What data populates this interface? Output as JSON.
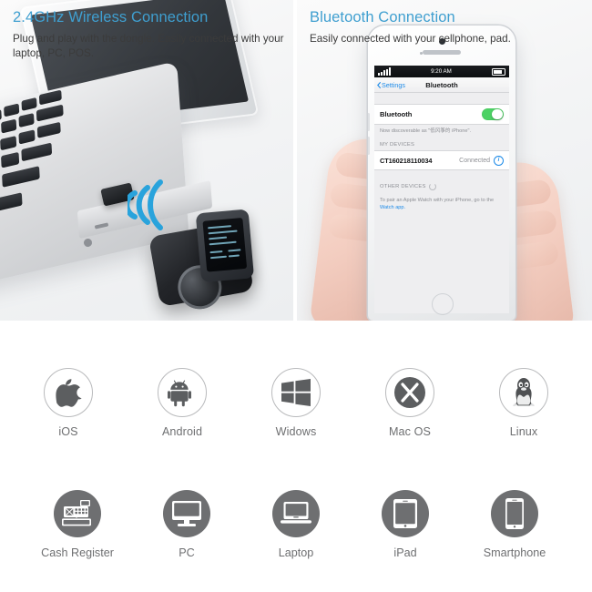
{
  "panels": [
    {
      "id": "wireless",
      "title": "2.4GHz Wireless Connection",
      "subtitle": "Plug and play with the dongle. Easily connected with your laptop, PC, POS.",
      "photo_alt": "laptop-with-usb-dongle-and-barcode-scanner"
    },
    {
      "id": "bluetooth",
      "title": "Bluetooth Connection",
      "subtitle": "Easily connected with your cellphone, pad.",
      "photo_alt": "hands-holding-iphone-bluetooth-settings"
    }
  ],
  "phone": {
    "status": {
      "time": "9:20 AM"
    },
    "nav": {
      "back_label": "Settings",
      "title": "Bluetooth"
    },
    "bluetooth_row": {
      "label": "Bluetooth",
      "toggle_state": "on"
    },
    "discoverable_note": "Now discoverable as \"低风筝的 iPhone\".",
    "my_devices_header": "MY DEVICES",
    "device": {
      "name": "CT160218110034",
      "status": "Connected"
    },
    "other_devices_header": "OTHER DEVICES",
    "pair_note_prefix": "To pair an Apple Watch with your iPhone, go to the ",
    "pair_note_link": "Watch app."
  },
  "os_row": [
    {
      "label": "iOS",
      "icon": "apple-icon"
    },
    {
      "label": "Android",
      "icon": "android-icon"
    },
    {
      "label": "Widows",
      "icon": "windows-icon"
    },
    {
      "label": "Mac OS",
      "icon": "macos-x-icon"
    },
    {
      "label": "Linux",
      "icon": "linux-penguin-icon"
    }
  ],
  "device_row": [
    {
      "label": "Cash Register",
      "icon": "cash-register-icon"
    },
    {
      "label": "PC",
      "icon": "desktop-monitor-icon"
    },
    {
      "label": "Laptop",
      "icon": "laptop-icon"
    },
    {
      "label": "iPad",
      "icon": "tablet-icon"
    },
    {
      "label": "Smartphone",
      "icon": "smartphone-icon"
    }
  ],
  "colors": {
    "heading_blue": "#3f9fd0",
    "body_text": "#3b3b3b",
    "icon_gray": "#6e6f71",
    "circle_outline": "#b9babc",
    "wifi_arc_blue": "#29a3dc",
    "toggle_green": "#4cd264",
    "ios_link_blue": "#1c8ae8"
  }
}
